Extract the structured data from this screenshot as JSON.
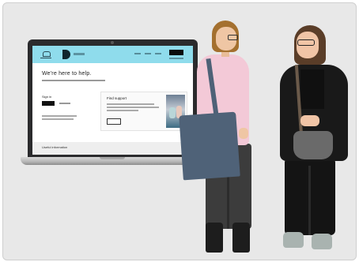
{
  "website": {
    "title": "We're here to help.",
    "signin_label": "Sign in",
    "support_title": "Find support",
    "footer_title": "Useful information"
  },
  "colors": {
    "header_accent": "#8fdcec",
    "background": "#e8e8e8",
    "bag": "#4f6278"
  }
}
